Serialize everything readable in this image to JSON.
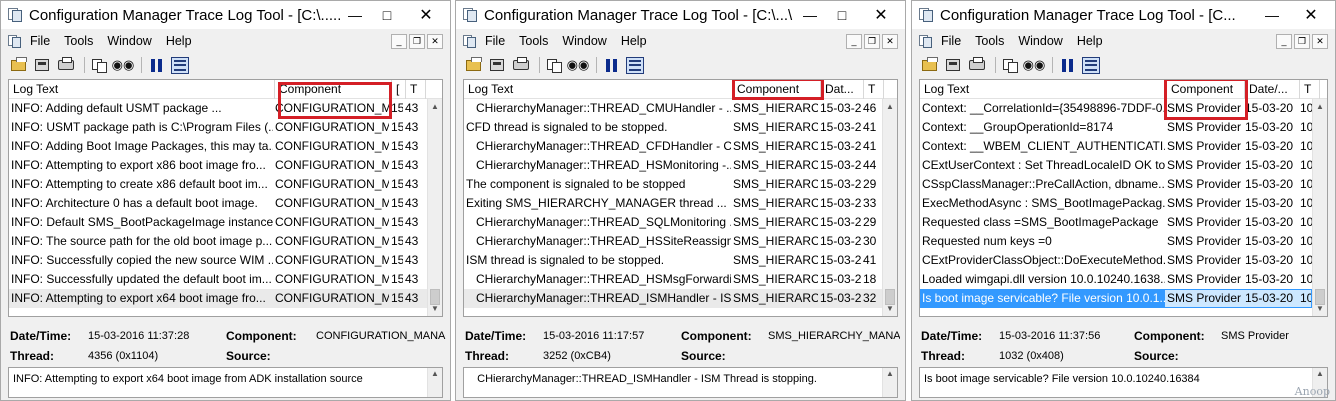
{
  "windows": [
    {
      "title": "Configuration Manager Trace Log Tool - [C:\\.....",
      "menu": [
        "File",
        "Tools",
        "Window",
        "Help"
      ],
      "columns": [
        "Log Text",
        "Component",
        "[",
        "T"
      ],
      "rows": [
        [
          "INFO: Adding default USMT package ...",
          "CONFIGURATION_M",
          "15",
          "43"
        ],
        [
          "INFO: USMT package path is C:\\Program Files (...",
          "CONFIGURATION_M",
          "15",
          "43"
        ],
        [
          "INFO: Adding Boot Image Packages, this may ta...",
          "CONFIGURATION_M",
          "15",
          "43"
        ],
        [
          "INFO: Attempting to export x86 boot image fro...",
          "CONFIGURATION_M",
          "15",
          "43"
        ],
        [
          "INFO: Attempting to create x86 default boot im...",
          "CONFIGURATION_M",
          "15",
          "43"
        ],
        [
          "INFO: Architecture 0 has a default boot image.",
          "CONFIGURATION_M",
          "15",
          "43"
        ],
        [
          "INFO: Default SMS_BootPackageImage instance...",
          "CONFIGURATION_M",
          "15",
          "43"
        ],
        [
          "INFO: The source path for the old boot image p...",
          "CONFIGURATION_M",
          "15",
          "43"
        ],
        [
          "INFO: Successfully copied the new source WIM ...",
          "CONFIGURATION_M",
          "15",
          "43"
        ],
        [
          "INFO: Successfully updated the default boot im...",
          "CONFIGURATION_M",
          "15",
          "43"
        ],
        [
          "INFO: Attempting to export x64 boot image fro...",
          "CONFIGURATION_M",
          "15",
          "43"
        ]
      ],
      "details": {
        "datetime_label": "Date/Time:",
        "datetime": "15-03-2016 11:37:28",
        "component_label": "Component:",
        "component": "CONFIGURATION_MANAGE",
        "thread_label": "Thread:",
        "thread": "4356 (0x1104)",
        "source_label": "Source:",
        "source": ""
      },
      "message": "INFO: Attempting to export x64 boot image from ADK installation source"
    },
    {
      "title": "Configuration Manager Trace Log Tool - [C:\\...\\",
      "menu": [
        "File",
        "Tools",
        "Window",
        "Help"
      ],
      "columns": [
        "Log Text",
        "Component",
        "Dat...",
        "T"
      ],
      "rows": [
        [
          "   CHierarchyManager::THREAD_CMUHandler - ...",
          "SMS_HIERARCH",
          "15-03-2",
          "46"
        ],
        [
          "CFD thread is signaled to be stopped.",
          "SMS_HIERARCH",
          "15-03-2",
          "41"
        ],
        [
          "   CHierarchyManager::THREAD_CFDHandler - C...",
          "SMS_HIERARCH",
          "15-03-2",
          "41"
        ],
        [
          "   CHierarchyManager::THREAD_HSMonitoring -...",
          "SMS_HIERARCH",
          "15-03-2",
          "44"
        ],
        [
          "The component is signaled to be stopped",
          "SMS_HIERARCH",
          "15-03-2",
          "29"
        ],
        [
          "Exiting SMS_HIERARCHY_MANAGER thread ...",
          "SMS_HIERARCH",
          "15-03-2",
          "33"
        ],
        [
          "   CHierarchyManager::THREAD_SQLMonitoring ...",
          "SMS_HIERARCH",
          "15-03-2",
          "29"
        ],
        [
          "   CHierarchyManager::THREAD_HSSiteReassign ...",
          "SMS_HIERARCH",
          "15-03-2",
          "30"
        ],
        [
          "ISM thread is signaled to be stopped.",
          "SMS_HIERARCH",
          "15-03-2",
          "41"
        ],
        [
          "   CHierarchyManager::THREAD_HSMsgForwardi...",
          "SMS_HIERARCH",
          "15-03-2",
          "18"
        ],
        [
          "   CHierarchyManager::THREAD_ISMHandler - IS...",
          "SMS_HIERARCH",
          "15-03-2",
          "32"
        ]
      ],
      "details": {
        "datetime_label": "Date/Time:",
        "datetime": "15-03-2016 11:17:57",
        "component_label": "Component:",
        "component": "SMS_HIERARCHY_MANAGE",
        "thread_label": "Thread:",
        "thread": "3252 (0xCB4)",
        "source_label": "Source:",
        "source": ""
      },
      "message": "   CHierarchyManager::THREAD_ISMHandler - ISM Thread is stopping."
    },
    {
      "title": "Configuration Manager Trace Log Tool - [C...",
      "menu": [
        "File",
        "Tools",
        "Window",
        "Help"
      ],
      "columns": [
        "Log Text",
        "Component",
        "Date/...",
        "T"
      ],
      "rows": [
        [
          "Context: __CorrelationId={35498896-7DDF-0...",
          "SMS Provider",
          "15-03-20",
          "10"
        ],
        [
          "Context: __GroupOperationId=8174",
          "SMS Provider",
          "15-03-20",
          "10"
        ],
        [
          "Context: __WBEM_CLIENT_AUTHENTICATI...",
          "SMS Provider",
          "15-03-20",
          "10"
        ],
        [
          "CExtUserContext : Set ThreadLocaleID OK to...",
          "SMS Provider",
          "15-03-20",
          "10"
        ],
        [
          "CSspClassManager::PreCallAction, dbname...",
          "SMS Provider",
          "15-03-20",
          "10"
        ],
        [
          "ExecMethodAsync : SMS_BootImagePackag...",
          "SMS Provider",
          "15-03-20",
          "10"
        ],
        [
          "Requested class =SMS_BootImagePackage",
          "SMS Provider",
          "15-03-20",
          "10"
        ],
        [
          "Requested num keys =0",
          "SMS Provider",
          "15-03-20",
          "10"
        ],
        [
          "CExtProviderClassObject::DoExecuteMethod...",
          "SMS Provider",
          "15-03-20",
          "10"
        ],
        [
          "Loaded wimgapi.dll version 10.0.10240.1638...",
          "SMS Provider",
          "15-03-20",
          "10"
        ],
        [
          "Is boot image servicable? File version 10.0.1...",
          "SMS Provider",
          "15-03-20",
          "10"
        ]
      ],
      "details": {
        "datetime_label": "Date/Time:",
        "datetime": "15-03-2016 11:37:56",
        "component_label": "Component:",
        "component": "SMS Provider",
        "thread_label": "Thread:",
        "thread": "1032 (0x408)",
        "source_label": "Source:",
        "source": ""
      },
      "message": "Is boot image servicable? File version 10.0.10240.16384"
    }
  ],
  "icons": {
    "app": "trace-log-app-icon",
    "toolbar": [
      "open-folder-icon",
      "save-icon",
      "print-icon",
      "copy-icon",
      "find-icon",
      "pause-icon",
      "filter-list-icon"
    ],
    "title_buttons": [
      "minimize-icon",
      "maximize-icon",
      "close-icon"
    ]
  },
  "colors": {
    "highlight_box": "#d41f26",
    "selection_blue": "#3399ff",
    "selection_grey": "#eaeaea",
    "pause_blue": "#0b2b8c"
  },
  "watermark": "Anoop"
}
